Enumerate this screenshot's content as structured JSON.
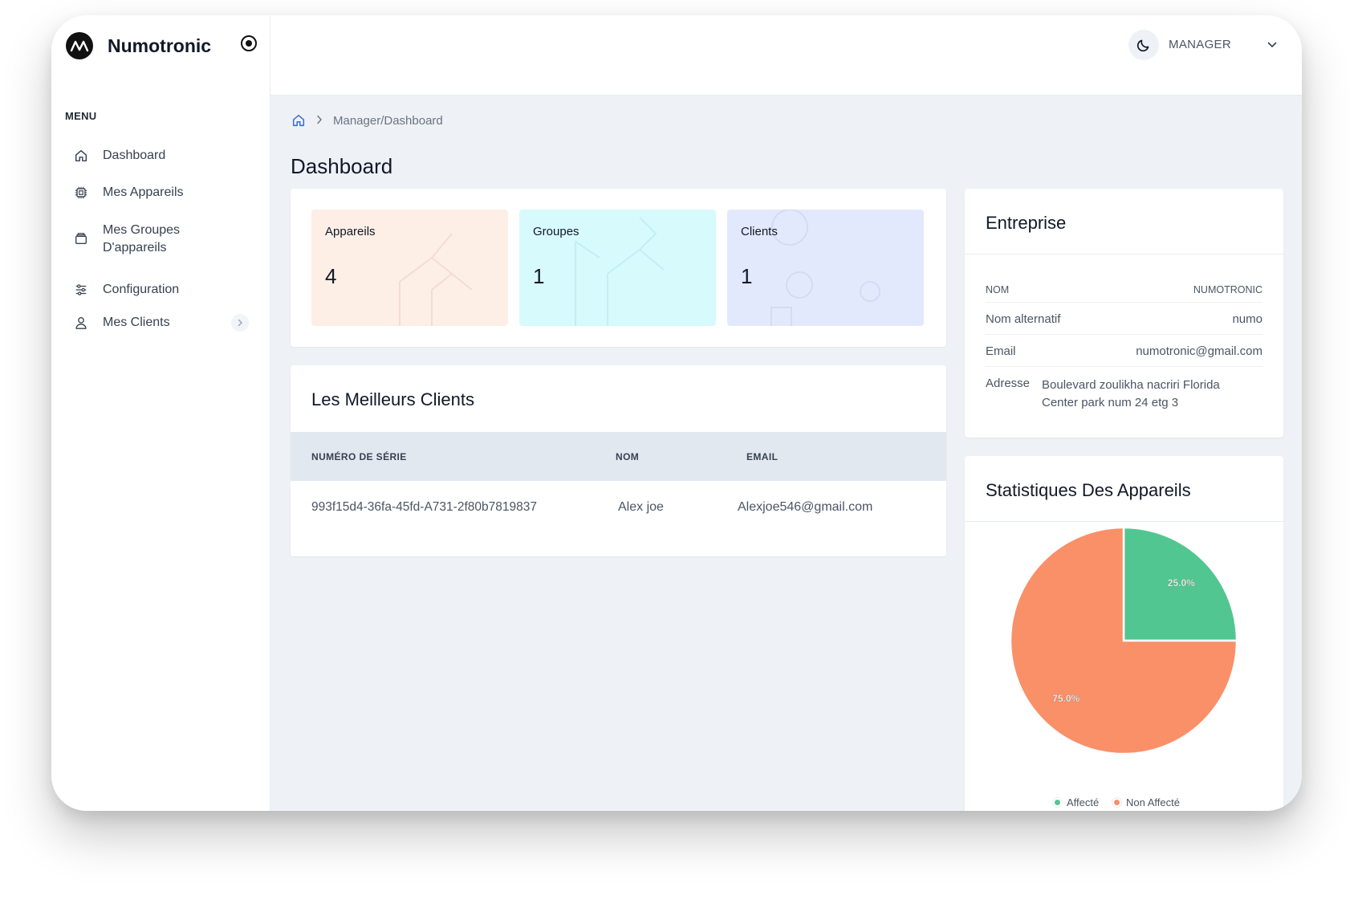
{
  "brand": {
    "name": "Numotronic"
  },
  "sidebar": {
    "menu_title": "MENU",
    "items": [
      {
        "label": "Dashboard",
        "icon": "home-icon"
      },
      {
        "label": "Mes Appareils",
        "icon": "chip-icon"
      },
      {
        "label": "Mes Groupes D'appareils",
        "icon": "folder-icon"
      },
      {
        "label": "Configuration",
        "icon": "sliders-icon"
      },
      {
        "label": "Mes Clients",
        "icon": "user-icon"
      }
    ]
  },
  "topbar": {
    "role": "MANAGER"
  },
  "breadcrumb": {
    "path": "Manager/Dashboard"
  },
  "page": {
    "title": "Dashboard"
  },
  "stats": [
    {
      "label": "Appareils",
      "value": "4",
      "bg": "#fdeee6"
    },
    {
      "label": "Groupes",
      "value": "1",
      "bg": "#d7fafd"
    },
    {
      "label": "Clients",
      "value": "1",
      "bg": "#e3e9fc"
    }
  ],
  "clients": {
    "title": "Les Meilleurs Clients",
    "columns": [
      "NUMÉRO DE SÉRIE",
      "NOM",
      "EMAIL"
    ],
    "rows": [
      {
        "serial": "993f15d4-36fa-45fd-A731-2f80b7819837",
        "name": "Alex joe",
        "email": "Alexjoe546@gmail.com"
      }
    ]
  },
  "entreprise": {
    "title": "Entreprise",
    "rows": [
      {
        "key": "NOM",
        "value": "NUMOTRONIC"
      },
      {
        "key": "Nom alternatif",
        "value": "numo"
      },
      {
        "key": "Email",
        "value": "numotronic@gmail.com"
      },
      {
        "key": "Adresse",
        "value_line1": "Boulevard zoulikha nacriri Florida",
        "value_line2": "Center park num 24 etg 3"
      }
    ]
  },
  "statistiques": {
    "title": "Statistiques Des Appareils"
  },
  "chart_data": {
    "type": "pie",
    "categories": [
      "Affecté",
      "Non Affecté"
    ],
    "values": [
      25.0,
      75.0
    ],
    "labels": [
      "25.0%",
      "75.0%"
    ],
    "colors": [
      "#52c690",
      "#f99068"
    ],
    "legend": "bottom"
  }
}
